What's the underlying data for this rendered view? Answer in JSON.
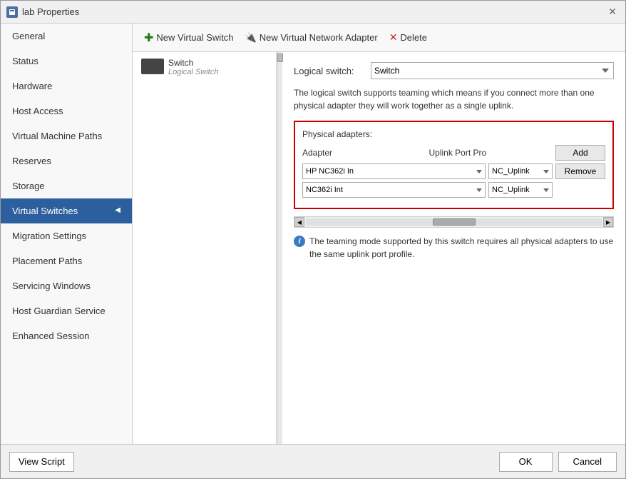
{
  "window": {
    "title": "lab Properties",
    "close_label": "✕"
  },
  "sidebar": {
    "items": [
      {
        "id": "general",
        "label": "General",
        "active": false
      },
      {
        "id": "status",
        "label": "Status",
        "active": false
      },
      {
        "id": "hardware",
        "label": "Hardware",
        "active": false
      },
      {
        "id": "host-access",
        "label": "Host Access",
        "active": false
      },
      {
        "id": "vm-paths",
        "label": "Virtual Machine Paths",
        "active": false
      },
      {
        "id": "reserves",
        "label": "Reserves",
        "active": false
      },
      {
        "id": "storage",
        "label": "Storage",
        "active": false
      },
      {
        "id": "virtual-switches",
        "label": "Virtual Switches",
        "active": true
      },
      {
        "id": "migration-settings",
        "label": "Migration Settings",
        "active": false
      },
      {
        "id": "placement-paths",
        "label": "Placement Paths",
        "active": false
      },
      {
        "id": "servicing-windows",
        "label": "Servicing Windows",
        "active": false
      },
      {
        "id": "host-guardian",
        "label": "Host Guardian Service",
        "active": false
      },
      {
        "id": "enhanced-session",
        "label": "Enhanced Session",
        "active": false
      }
    ]
  },
  "toolbar": {
    "new_virtual_switch_label": "New Virtual Switch",
    "new_virtual_network_adapter_label": "New Virtual Network Adapter",
    "delete_label": "Delete"
  },
  "switch_panel": {
    "switch_name": "Switch",
    "switch_subtitle": "Logical Switch"
  },
  "right_panel": {
    "logical_switch_label": "Logical switch:",
    "logical_switch_value": "Switch",
    "description": "The logical switch supports teaming which means if you connect more than one physical adapter they will work together as a single uplink.",
    "physical_adapters_title": "Physical adapters:",
    "adapter_col": "Adapter",
    "uplink_col": "Uplink Port Pro",
    "add_btn": "Add",
    "remove_btn": "Remove",
    "adapters": [
      {
        "adapter": "HP NC362i In",
        "uplink": "NC_Uplink"
      },
      {
        "adapter": "NC362i Int",
        "uplink": "NC_Uplink"
      }
    ],
    "info_text": "The teaming mode supported by this switch requires all physical adapters to use the same uplink port profile."
  },
  "footer": {
    "view_script_label": "View Script",
    "ok_label": "OK",
    "cancel_label": "Cancel"
  }
}
